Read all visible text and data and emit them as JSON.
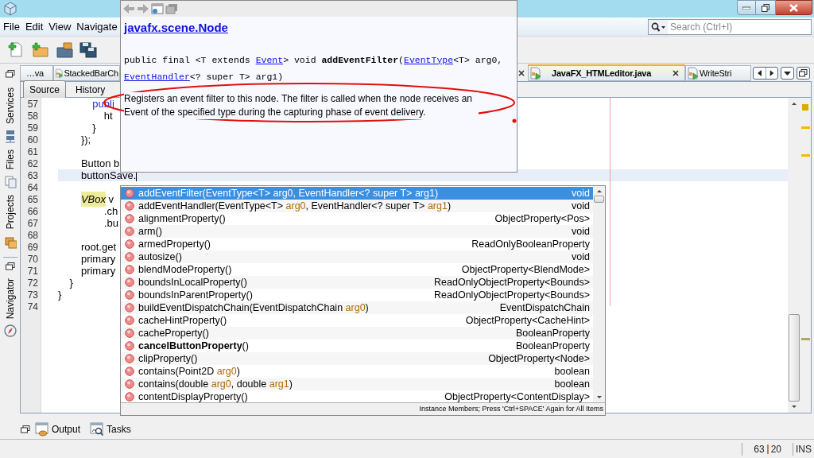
{
  "menu": [
    {
      "label": "File"
    },
    {
      "label": "Edit"
    },
    {
      "label": "View"
    },
    {
      "label": "Navigate"
    }
  ],
  "search": {
    "placeholder": "Search (Ctrl+I)"
  },
  "side_tabs": [
    {
      "label": "Services",
      "kind": "services"
    },
    {
      "label": "Files",
      "kind": "files"
    },
    {
      "label": "Projects",
      "kind": "projects"
    },
    {
      "label": "Navigator",
      "kind": "navigator"
    }
  ],
  "editor_tabs": [
    {
      "label": "…va",
      "selected": false,
      "icon": false
    },
    {
      "label": "StackedBarCh",
      "selected": false,
      "icon": true
    },
    {
      "label": "JavaFX_HTMLeditor.java",
      "selected": true,
      "icon": true
    },
    {
      "label": "WriteStri",
      "selected": false,
      "icon": true
    }
  ],
  "editor_toolbar": [
    {
      "label": "Source",
      "selected": true
    },
    {
      "label": "History",
      "selected": false
    }
  ],
  "code_lines": [
    {
      "number": "57",
      "parts": [
        {
          "text": "            publi",
          "kind": "keyword"
        }
      ]
    },
    {
      "number": "58",
      "parts": [
        {
          "text": "                ht",
          "kind": "plain"
        }
      ]
    },
    {
      "number": "59",
      "parts": [
        {
          "text": "            }",
          "kind": "plain"
        }
      ]
    },
    {
      "number": "60",
      "parts": [
        {
          "text": "        });",
          "kind": "plain"
        }
      ]
    },
    {
      "number": "61"
    },
    {
      "number": "62",
      "parts": [
        {
          "text": "        Button b",
          "kind": "plain"
        }
      ]
    },
    {
      "number": "63",
      "parts": [
        {
          "text": "        buttonSave.",
          "kind": "plain"
        }
      ],
      "current": true
    },
    {
      "number": "64"
    },
    {
      "number": "65",
      "parts": [
        {
          "text": "        VBox",
          "kind": "hint"
        },
        {
          "text": " v",
          "kind": "plain"
        }
      ]
    },
    {
      "number": "66",
      "parts": [
        {
          "text": "                .ch",
          "kind": "plain"
        }
      ]
    },
    {
      "number": "67",
      "parts": [
        {
          "text": "                .bu",
          "kind": "plain"
        }
      ]
    },
    {
      "number": "68"
    },
    {
      "number": "69",
      "parts": [
        {
          "text": "        root.get",
          "kind": "plain"
        }
      ]
    },
    {
      "number": "70",
      "parts": [
        {
          "text": "        primary",
          "kind": "plain"
        }
      ]
    },
    {
      "number": "71",
      "parts": [
        {
          "text": "        primary",
          "kind": "plain"
        }
      ]
    },
    {
      "number": "72",
      "parts": [
        {
          "text": "    }",
          "kind": "plain"
        }
      ]
    },
    {
      "number": "73",
      "parts": [
        {
          "text": "}",
          "kind": "plain"
        }
      ]
    },
    {
      "number": "74"
    }
  ],
  "doc_popup": {
    "title": "javafx.scene.Node",
    "signature": [
      [
        {
          "text": "public final <T extends ",
          "kind": "plain"
        },
        {
          "text": "Event",
          "kind": "link"
        },
        {
          "text": "> void ",
          "kind": "plain"
        },
        {
          "text": "addEventFilter",
          "kind": "bold"
        },
        {
          "text": "(",
          "kind": "plain"
        },
        {
          "text": "EventType",
          "kind": "link"
        },
        {
          "text": "<T> arg0,",
          "kind": "plain"
        }
      ],
      [
        {
          "text": "EventHandler",
          "kind": "link"
        },
        {
          "text": "<? super T> arg1)",
          "kind": "plain"
        }
      ]
    ],
    "description": "Registers an event filter to this node. The filter is called when the node receives an Event of the specified type during the capturing phase of event delivery."
  },
  "completion": {
    "items": [
      {
        "parts": [
          {
            "text": "addEventFilter(EventType<T> ",
            "kind": "plain"
          },
          {
            "text": "arg0",
            "kind": "param"
          },
          {
            "text": ", EventHandler<? super T> ",
            "kind": "plain"
          },
          {
            "text": "arg1",
            "kind": "param"
          },
          {
            "text": ")",
            "kind": "plain"
          }
        ],
        "type": "void",
        "selected": true
      },
      {
        "parts": [
          {
            "text": "addEventHandler(EventType<T> ",
            "kind": "plain"
          },
          {
            "text": "arg0",
            "kind": "param"
          },
          {
            "text": ", EventHandler<? super T> ",
            "kind": "plain"
          },
          {
            "text": "arg1",
            "kind": "param"
          },
          {
            "text": ")",
            "kind": "plain"
          }
        ],
        "type": "void",
        "selected": false
      },
      {
        "parts": [
          {
            "text": "alignmentProperty()",
            "kind": "plain"
          }
        ],
        "type": "ObjectProperty<Pos>",
        "selected": false
      },
      {
        "parts": [
          {
            "text": "arm()",
            "kind": "plain"
          }
        ],
        "type": "void",
        "selected": false
      },
      {
        "parts": [
          {
            "text": "armedProperty()",
            "kind": "plain"
          }
        ],
        "type": "ReadOnlyBooleanProperty",
        "selected": false
      },
      {
        "parts": [
          {
            "text": "autosize()",
            "kind": "plain"
          }
        ],
        "type": "void",
        "selected": false
      },
      {
        "parts": [
          {
            "text": "blendModeProperty()",
            "kind": "plain"
          }
        ],
        "type": "ObjectProperty<BlendMode>",
        "selected": false
      },
      {
        "parts": [
          {
            "text": "boundsInLocalProperty()",
            "kind": "plain"
          }
        ],
        "type": "ReadOnlyObjectProperty<Bounds>",
        "selected": false
      },
      {
        "parts": [
          {
            "text": "boundsInParentProperty()",
            "kind": "plain"
          }
        ],
        "type": "ReadOnlyObjectProperty<Bounds>",
        "selected": false
      },
      {
        "parts": [
          {
            "text": "buildEventDispatchChain(EventDispatchChain ",
            "kind": "plain"
          },
          {
            "text": "arg0",
            "kind": "param"
          },
          {
            "text": ")",
            "kind": "plain"
          }
        ],
        "type": "EventDispatchChain",
        "selected": false
      },
      {
        "parts": [
          {
            "text": "cacheHintProperty()",
            "kind": "plain"
          }
        ],
        "type": "ObjectProperty<CacheHint>",
        "selected": false
      },
      {
        "parts": [
          {
            "text": "cacheProperty()",
            "kind": "plain"
          }
        ],
        "type": "BooleanProperty",
        "selected": false
      },
      {
        "parts": [
          {
            "text": "cancelButtonProperty",
            "kind": "bold"
          },
          {
            "text": "()",
            "kind": "plain"
          }
        ],
        "type": "BooleanProperty",
        "selected": false
      },
      {
        "parts": [
          {
            "text": "clipProperty()",
            "kind": "plain"
          }
        ],
        "type": "ObjectProperty<Node>",
        "selected": false
      },
      {
        "parts": [
          {
            "text": "contains(Point2D ",
            "kind": "plain"
          },
          {
            "text": "arg0",
            "kind": "param"
          },
          {
            "text": ")",
            "kind": "plain"
          }
        ],
        "type": "boolean",
        "selected": false
      },
      {
        "parts": [
          {
            "text": "contains(double ",
            "kind": "plain"
          },
          {
            "text": "arg0",
            "kind": "param"
          },
          {
            "text": ", double ",
            "kind": "plain"
          },
          {
            "text": "arg1",
            "kind": "param"
          },
          {
            "text": ")",
            "kind": "plain"
          }
        ],
        "type": "boolean",
        "selected": false
      },
      {
        "parts": [
          {
            "text": "contentDisplayProperty()",
            "kind": "plain"
          }
        ],
        "type": "ObjectProperty<ContentDisplay>",
        "selected": false
      }
    ],
    "footer": "Instance Members; Press 'Ctrl+SPACE' Again for All Items"
  },
  "bottom_tabs": [
    {
      "label": "Output",
      "kind": "output"
    },
    {
      "label": "Tasks",
      "kind": "tasks"
    }
  ],
  "status_bar": {
    "line": "63",
    "column": "20",
    "mode": "INS"
  }
}
